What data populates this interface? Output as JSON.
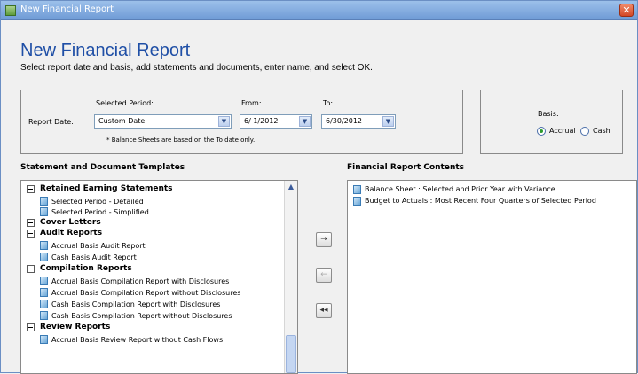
{
  "window": {
    "title": "New Financial Report"
  },
  "header": {
    "title": "New Financial Report",
    "subtitle": "Select report date and basis, add statements and documents, enter name, and select OK."
  },
  "report_date": {
    "label": "Report Date:",
    "selected_period_label": "Selected Period:",
    "selected_period_value": "Custom Date",
    "from_label": "From:",
    "from_value": "6/ 1/2012",
    "to_label": "To:",
    "to_value": "6/30/2012",
    "note": "* Balance Sheets are based on the To date only."
  },
  "basis": {
    "label": "Basis:",
    "options": [
      {
        "label": "Accrual",
        "selected": true
      },
      {
        "label": "Cash",
        "selected": false
      }
    ]
  },
  "templates": {
    "title": "Statement and Document Templates",
    "items": [
      {
        "kind": "group",
        "label": "Retained Earning Statements"
      },
      {
        "kind": "item",
        "label": "Selected Period - Detailed"
      },
      {
        "kind": "item",
        "label": "Selected Period - Simplified"
      },
      {
        "kind": "group",
        "label": "Cover Letters"
      },
      {
        "kind": "group",
        "label": "Audit Reports"
      },
      {
        "kind": "item",
        "label": "Accrual Basis Audit Report"
      },
      {
        "kind": "item",
        "label": "Cash Basis Audit Report"
      },
      {
        "kind": "group",
        "label": "Compilation Reports"
      },
      {
        "kind": "item",
        "label": "Accrual Basis Compilation Report with Disclosures"
      },
      {
        "kind": "item",
        "label": "Accrual Basis Compilation Report without Disclosures"
      },
      {
        "kind": "item",
        "label": "Cash Basis Compilation Report with Disclosures"
      },
      {
        "kind": "item",
        "label": "Cash Basis Compilation Report without Disclosures"
      },
      {
        "kind": "group",
        "label": "Review Reports"
      },
      {
        "kind": "item",
        "label": "Accrual Basis Review Report without Cash Flows"
      }
    ]
  },
  "contents": {
    "title": "Financial Report Contents",
    "items": [
      "Balance Sheet : Selected and Prior Year with Variance",
      "Budget to Actuals : Most Recent Four Quarters of Selected Period"
    ]
  },
  "buttons": {
    "add": "→",
    "remove": "←",
    "remove_all": "◂◂"
  },
  "icons": {
    "app": "app-icon",
    "close": "close-icon",
    "dropdown": "chevron-down-icon",
    "doc": "document-icon"
  }
}
